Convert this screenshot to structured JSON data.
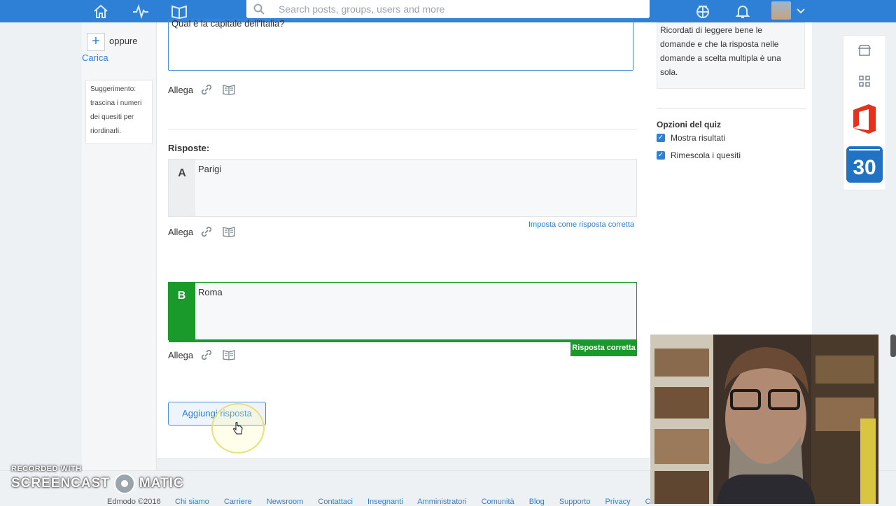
{
  "topbar": {
    "search_placeholder": "Search posts, groups, users and more",
    "icons": [
      "home-icon",
      "activity-icon",
      "library-icon",
      "backpack-icon",
      "bell-icon",
      "chevron-down-icon"
    ]
  },
  "left": {
    "oppure": "oppure",
    "carica": "Carica",
    "tip_lines": [
      "Suggerimento:",
      "trascina i numeri",
      "dei quesiti per",
      "riordinarli."
    ]
  },
  "question": {
    "text": "Qual è la capitale dell'Italia?"
  },
  "attach_label": "Allega",
  "answers": {
    "heading": "Risposte:",
    "a": {
      "letter": "A",
      "text": "Parigi",
      "set_correct": "Imposta come risposta corretta"
    },
    "b": {
      "letter": "B",
      "text": "Roma",
      "correct_label": "Risposta corretta"
    },
    "add_button": "Aggiungi risposta"
  },
  "right": {
    "hint_lines": [
      "Ricordati di leggere bene le",
      "domande e che la risposta nelle",
      "domande a scelta multipla è una",
      "sola."
    ],
    "options_title": "Opzioni del quiz",
    "option1": "Mostra risultati",
    "option2": "Rimescola i quesiti"
  },
  "apps": {
    "calendar_day": "30"
  },
  "footer": {
    "copyright": "Edmodo ©2016",
    "links": [
      "Chi siamo",
      "Carriere",
      "Newsroom",
      "Contattaci",
      "Insegnanti",
      "Amministratori",
      "Comunità",
      "Blog",
      "Supporto",
      "Privacy",
      "Co"
    ]
  },
  "watermark": {
    "line1": "RECORDED WITH",
    "line2a": "SCREENCAST",
    "line2b": "MATIC"
  },
  "colors": {
    "brand": "#2e7fd6",
    "correct": "#1a9a2a"
  }
}
